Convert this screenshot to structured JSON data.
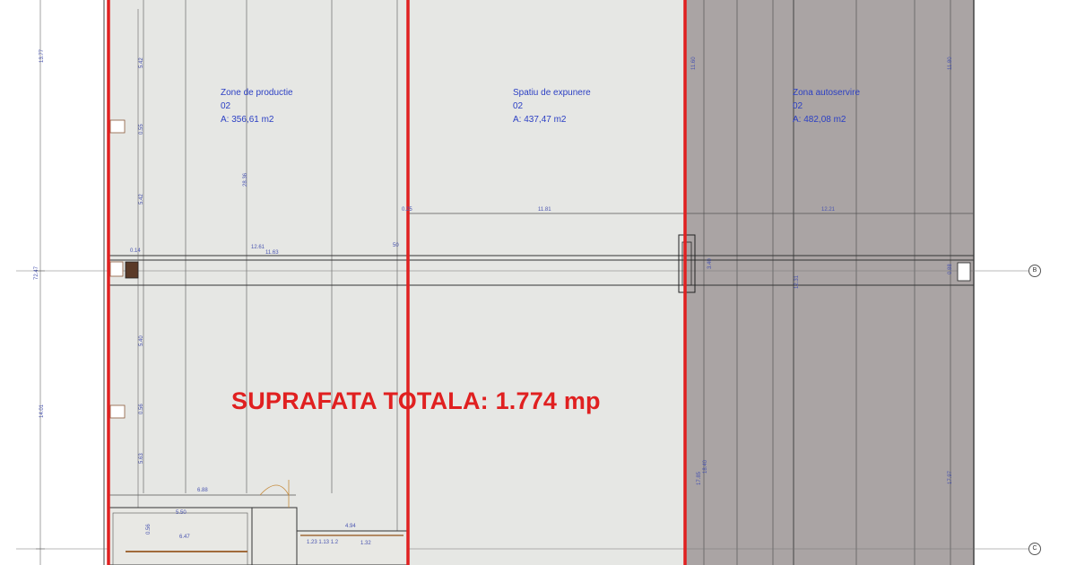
{
  "zones": [
    {
      "id": "productie",
      "name": "Zone de productie",
      "level": "02",
      "area": "A: 356,61 m2"
    },
    {
      "id": "expunere",
      "name": "Spatiu de expunere",
      "level": "02",
      "area": "A: 437,47 m2"
    },
    {
      "id": "autoservire",
      "name": "Zona autoservire",
      "level": "02",
      "area": "A: 482,08 m2"
    }
  ],
  "total": {
    "text": "SUPRAFATA TOTALA: 1.774 mp"
  },
  "dimensions": {
    "h_12_61": "12.61",
    "h_11_81": "11.81",
    "h_12_21": "12.21",
    "h_11_63": "11.63",
    "h_50": "50",
    "h_0_25": "0.25",
    "h_6_88": "6.88",
    "h_4_94": "4.94",
    "h_6_47": "6.47",
    "h_5_50": "5.50",
    "h_1_32": "1.32",
    "h_1_23": "1.23 1.13 1.2",
    "h_0_14": "0.14",
    "v_5_42a": "5.42",
    "v_5_42b": "5.42",
    "v_0_55": "0.55",
    "v_28_36": "28.36",
    "v_5_40": "5.40",
    "v_0_56": "0.56",
    "v_5_63": "5.63",
    "v_11_60": "11.60",
    "v_11_80": "11.80",
    "v_17_85": "17.85",
    "v_18_40": "18.40",
    "v_17_97": "17.97",
    "v_3_40": "3.40",
    "v_12_31": "12.31",
    "v_72_47": "72.47",
    "v_0_88": "0.88",
    "v_13_77": "13.77",
    "v_14_01": "14.01",
    "v_0_56b": "0.56"
  },
  "axes": {
    "a": "B",
    "b": "C"
  },
  "colors": {
    "boundary": "#e02020",
    "zone_light": "#e6e7e4",
    "zone_dark": "#a9a3a3",
    "dim_text": "#2b3fc4",
    "line": "#555555"
  }
}
